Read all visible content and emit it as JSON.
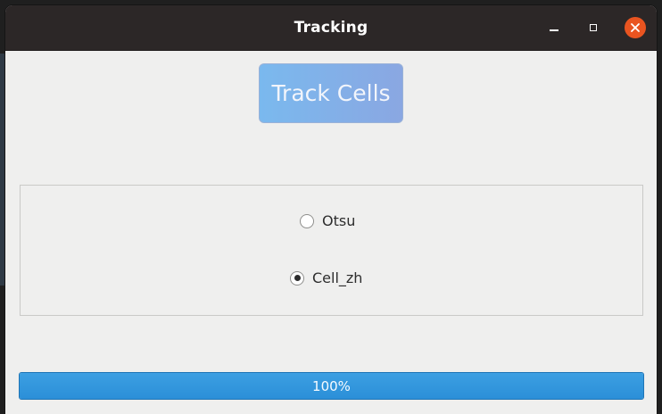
{
  "window": {
    "title": "Tracking",
    "controls": {
      "minimize_icon": "minimize-icon",
      "maximize_icon": "maximize-icon",
      "close_icon": "close-icon",
      "close_color": "#e95420"
    }
  },
  "main": {
    "track_button_label": "Track Cells",
    "track_button_colors": [
      "#7ab9ee",
      "#8aa7e2"
    ],
    "radio_group": {
      "options": [
        {
          "label": "Otsu",
          "selected": false
        },
        {
          "label": "Cell_zh",
          "selected": true
        }
      ]
    },
    "progress": {
      "value": 100,
      "text": "100%",
      "fill_color": "#2b8fd8"
    }
  }
}
